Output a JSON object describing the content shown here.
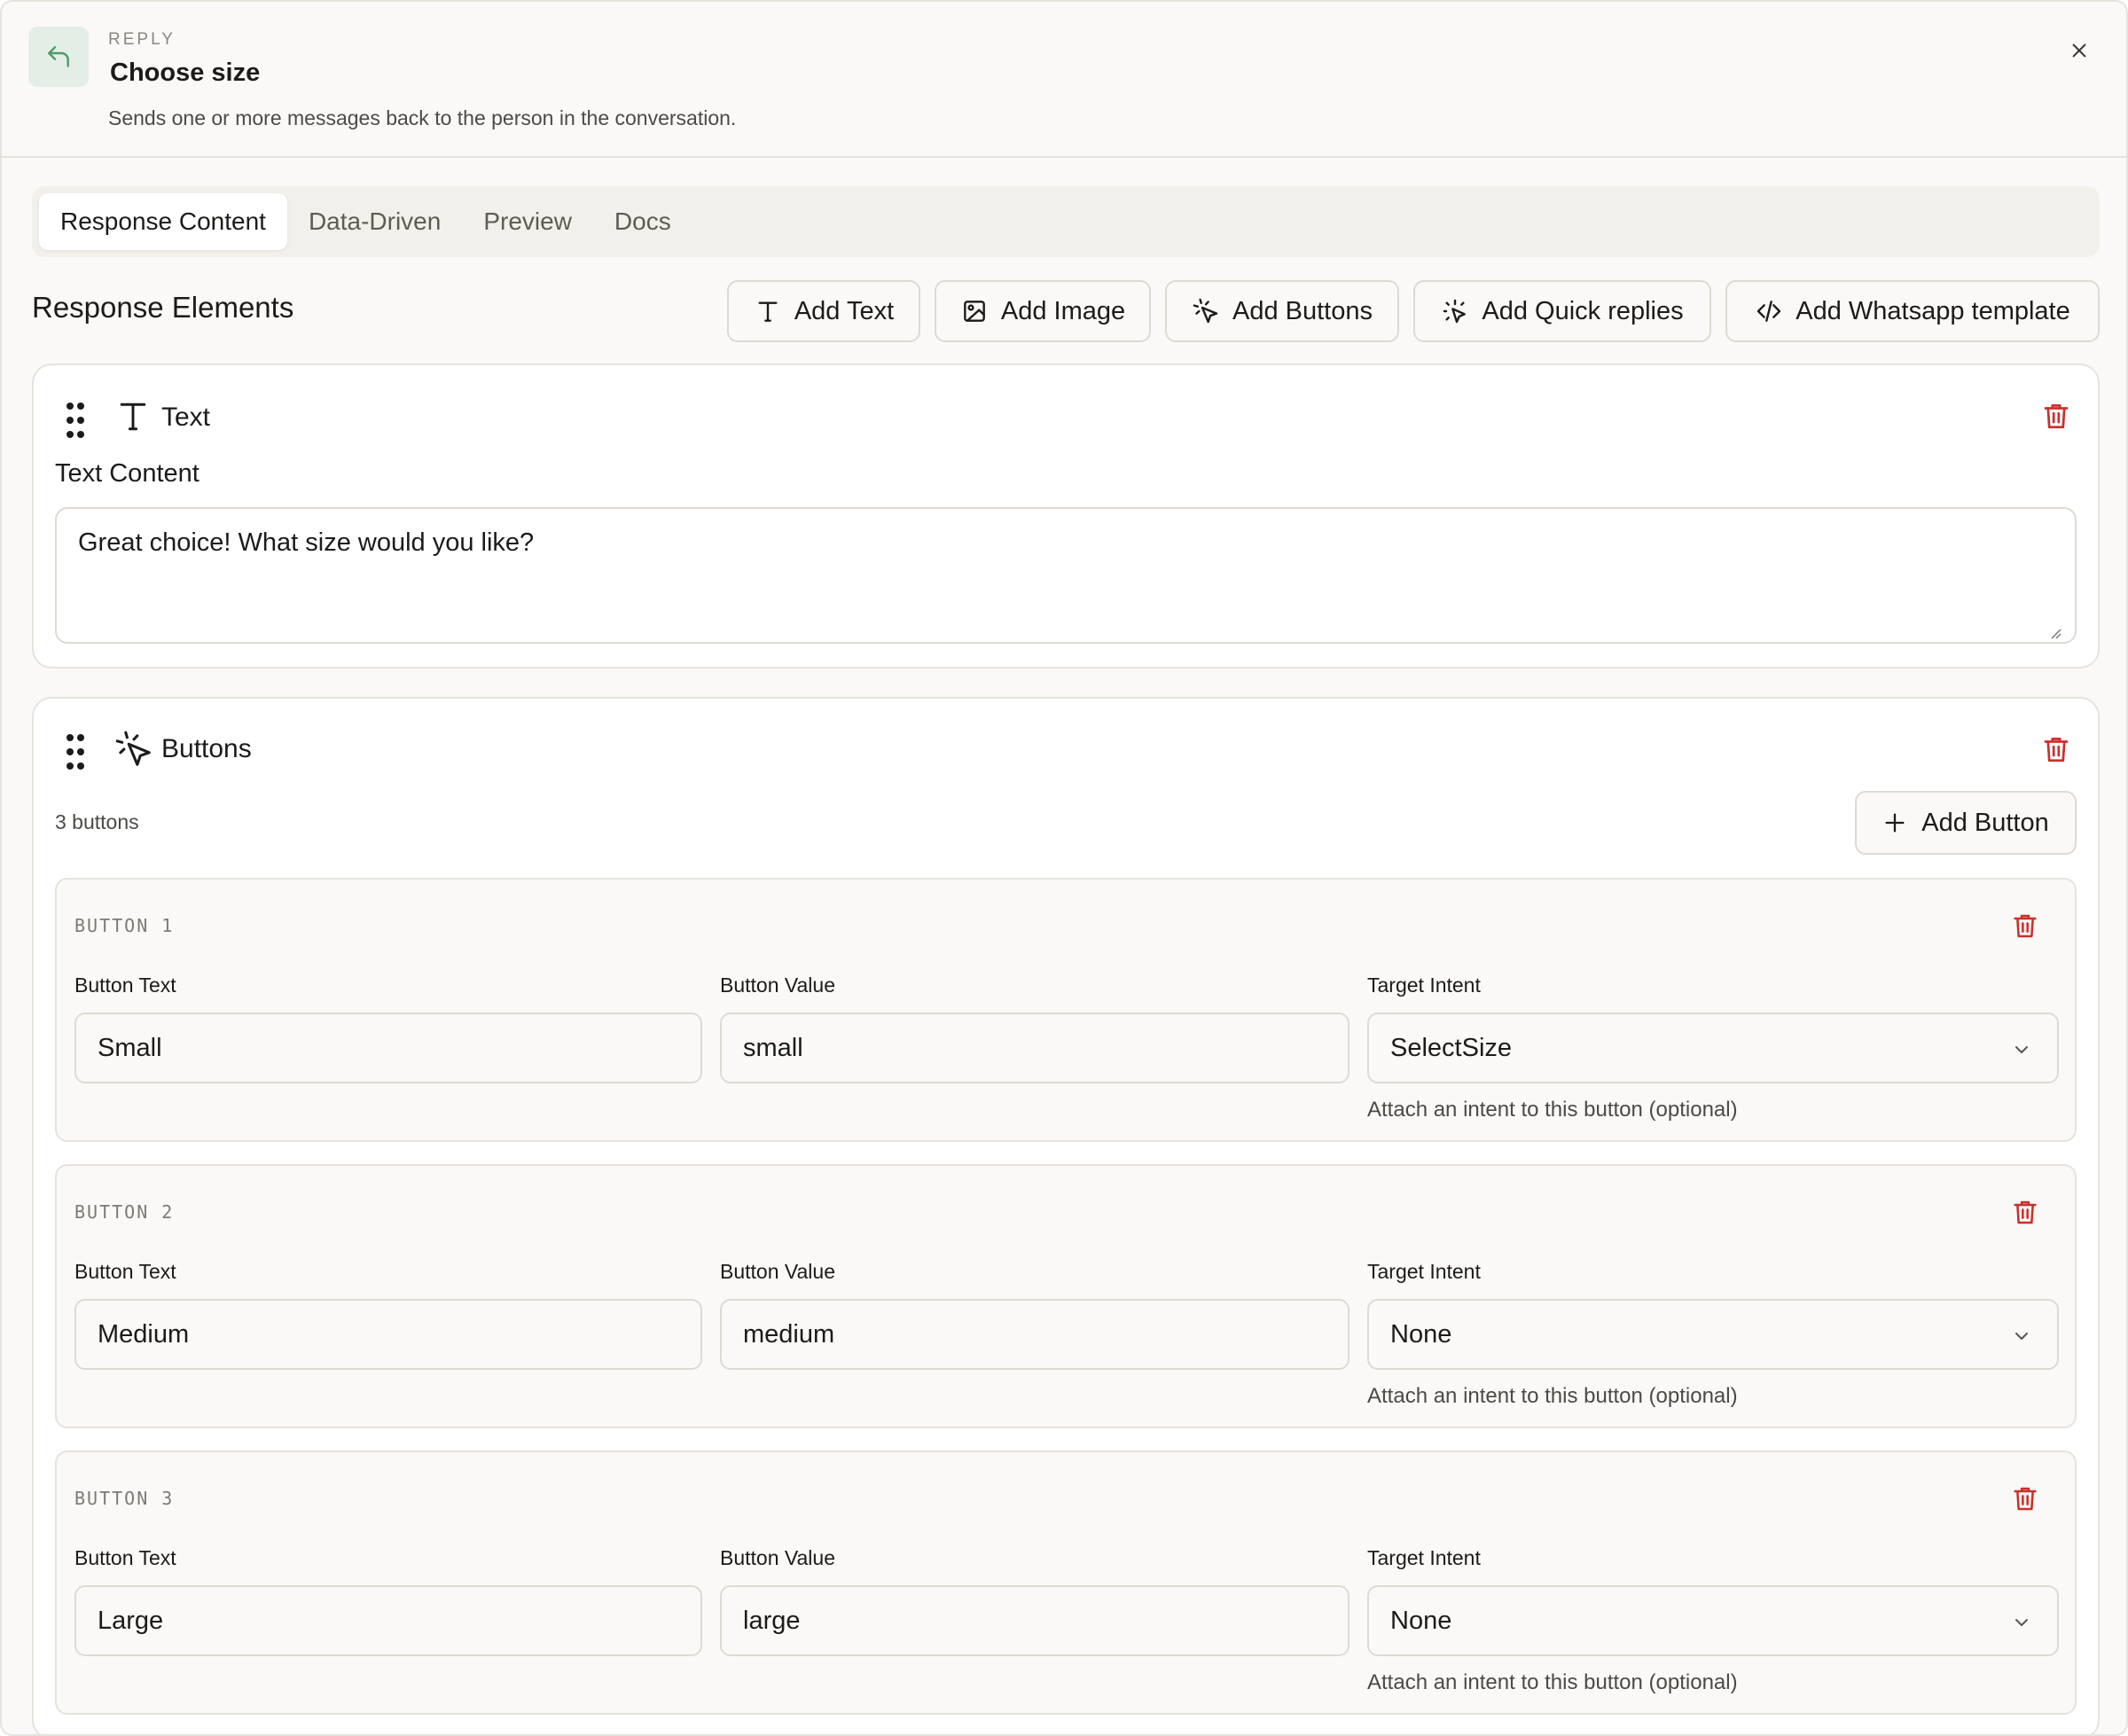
{
  "header": {
    "kind": "REPLY",
    "title": "Choose size",
    "description": "Sends one or more messages back to the person in the conversation."
  },
  "tabs": [
    {
      "label": "Response Content",
      "active": true
    },
    {
      "label": "Data-Driven",
      "active": false
    },
    {
      "label": "Preview",
      "active": false
    },
    {
      "label": "Docs",
      "active": false
    }
  ],
  "section_title": "Response Elements",
  "add_actions": {
    "text": "Add Text",
    "image": "Add Image",
    "buttons": "Add Buttons",
    "quick_replies": "Add Quick replies",
    "whatsapp": "Add Whatsapp template"
  },
  "text_card": {
    "type_label": "Text",
    "field_label": "Text Content",
    "value": "Great choice! What size would you like?"
  },
  "buttons_card": {
    "type_label": "Buttons",
    "count_text": "3 buttons",
    "add_button_label": "Add Button",
    "col_labels": {
      "text": "Button Text",
      "value": "Button Value",
      "intent": "Target Intent"
    },
    "hint": "Attach an intent to this button (optional)",
    "items": [
      {
        "label": "BUTTON 1",
        "text": "Small",
        "value": "small",
        "intent": "SelectSize"
      },
      {
        "label": "BUTTON 2",
        "text": "Medium",
        "value": "medium",
        "intent": "None"
      },
      {
        "label": "BUTTON 3",
        "text": "Large",
        "value": "large",
        "intent": "None"
      }
    ]
  },
  "colors": {
    "accent_green": "#4f9a68",
    "danger_red": "#c9302c",
    "panel_bg": "#faf9f7",
    "border": "#e6e3dd"
  }
}
